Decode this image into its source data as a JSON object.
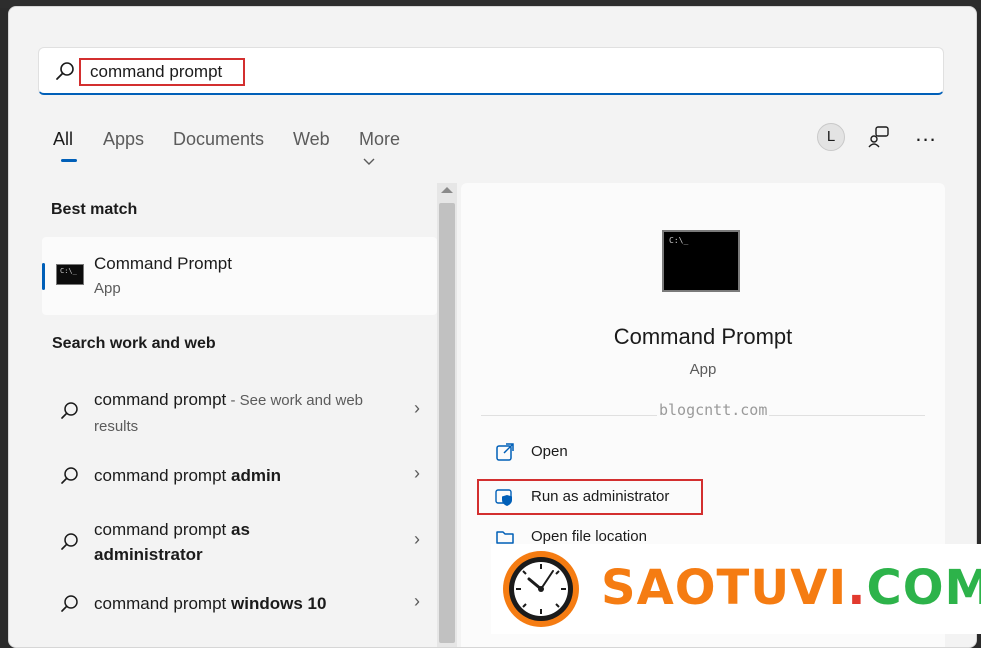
{
  "search": {
    "value": "command prompt",
    "icon": "search-icon"
  },
  "tabs": [
    {
      "label": "All",
      "active": true
    },
    {
      "label": "Apps",
      "active": false
    },
    {
      "label": "Documents",
      "active": false
    },
    {
      "label": "Web",
      "active": false
    },
    {
      "label": "More",
      "active": false
    }
  ],
  "header_actions": {
    "avatar_letter": "L",
    "more_glyph": "..."
  },
  "best_match": {
    "heading": "Best match",
    "title": "Command Prompt",
    "subtitle": "App",
    "icon_glyph": "C:\\_"
  },
  "search_web": {
    "heading": "Search work and web",
    "items": [
      {
        "plain": "command prompt",
        "bold": "",
        "hint": " - See work and web results"
      },
      {
        "plain": "command prompt ",
        "bold": "admin",
        "hint": ""
      },
      {
        "plain": "command prompt ",
        "bold": "as administrator",
        "hint": ""
      },
      {
        "plain": "command prompt ",
        "bold": "windows 10",
        "hint": ""
      }
    ]
  },
  "preview": {
    "title": "Command Prompt",
    "subtitle": "App",
    "watermark": "blogcntt.com",
    "icon_glyph": "C:\\_",
    "actions": [
      {
        "label": "Open",
        "icon": "open-external-icon"
      },
      {
        "label": "Run as administrator",
        "icon": "shield-icon"
      },
      {
        "label": "Open file location",
        "icon": "folder-icon"
      }
    ]
  },
  "logo": {
    "part1": "SAOTUVI",
    "dot": ".",
    "part2": "COM"
  },
  "colors": {
    "accent": "#005fb8",
    "highlight_box": "#d32f2f",
    "logo_orange": "#f57c12",
    "logo_green": "#2db34a"
  }
}
